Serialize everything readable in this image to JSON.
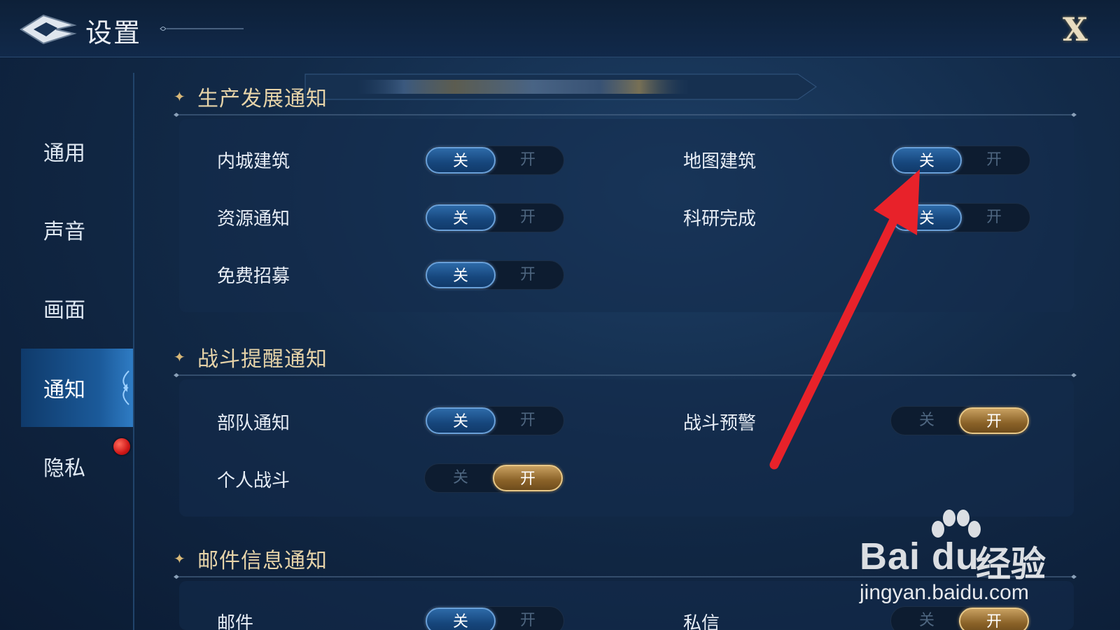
{
  "header": {
    "title": "设置",
    "close_label": "X"
  },
  "sidebar": {
    "items": [
      {
        "label": "通用"
      },
      {
        "label": "声音"
      },
      {
        "label": "画面"
      },
      {
        "label": "通知"
      },
      {
        "label": "隐私"
      }
    ],
    "active": "通知"
  },
  "sections": [
    {
      "title": "生产发展通知",
      "rows": [
        {
          "label": "内城建筑",
          "off": "关",
          "on": "开",
          "state": "off"
        },
        {
          "label": "地图建筑",
          "off": "关",
          "on": "开",
          "state": "off"
        },
        {
          "label": "资源通知",
          "off": "关",
          "on": "开",
          "state": "off"
        },
        {
          "label": "科研完成",
          "off": "关",
          "on": "开",
          "state": "off"
        },
        {
          "label": "免费招募",
          "off": "关",
          "on": "开",
          "state": "off"
        }
      ]
    },
    {
      "title": "战斗提醒通知",
      "rows": [
        {
          "label": "部队通知",
          "off": "关",
          "on": "开",
          "state": "off"
        },
        {
          "label": "战斗预警",
          "off": "关",
          "on": "开",
          "state": "on"
        },
        {
          "label": "个人战斗",
          "off": "关",
          "on": "开",
          "state": "on"
        }
      ]
    },
    {
      "title": "邮件信息通知",
      "rows": [
        {
          "label": "邮件",
          "off": "关",
          "on": "开",
          "state": "off"
        },
        {
          "label": "私信",
          "off": "关",
          "on": "开",
          "state": "on"
        }
      ]
    }
  ],
  "watermark": {
    "brand": "Bai du",
    "brand_cn": "经验",
    "url": "jingyan.baidu.com"
  },
  "colors": {
    "accent_blue": "#2d6aa8",
    "accent_gold": "#c8a060",
    "arrow_red": "#e8222a",
    "section_title": "#e6d3a8"
  }
}
